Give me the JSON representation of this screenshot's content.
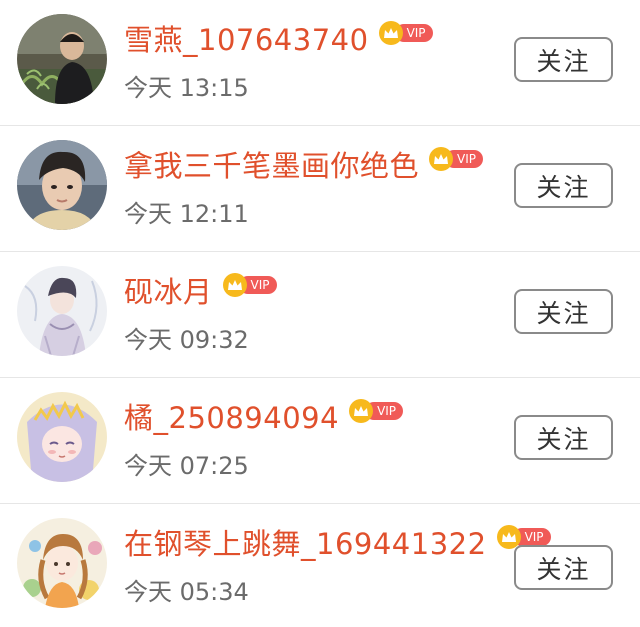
{
  "followers": [
    {
      "name": "雪燕_107643740",
      "time": "今天 13:15",
      "vip": "VIP",
      "follow_label": "关注",
      "avatar": "man-in-garden"
    },
    {
      "name": "拿我三千笔墨画你绝色",
      "time": "今天 12:11",
      "vip": "VIP",
      "follow_label": "关注",
      "avatar": "young-man-portrait"
    },
    {
      "name": "砚冰月",
      "time": "今天 09:32",
      "vip": "VIP",
      "follow_label": "关注",
      "avatar": "anime-boy-sketch"
    },
    {
      "name": "橘_250894094",
      "time": "今天 07:25",
      "vip": "VIP",
      "follow_label": "关注",
      "avatar": "anime-girl-lavender"
    },
    {
      "name": "在钢琴上跳舞_169441322",
      "time": "今天 05:34",
      "vip": "VIP",
      "follow_label": "关注",
      "avatar": "illustrated-girl-flowers"
    }
  ],
  "colors": {
    "name": "#e0502c",
    "time": "#6b6b6b",
    "vip_crown": "#f7b91c",
    "vip_tag": "#f05a57",
    "follow_border": "#8a8a8a"
  }
}
